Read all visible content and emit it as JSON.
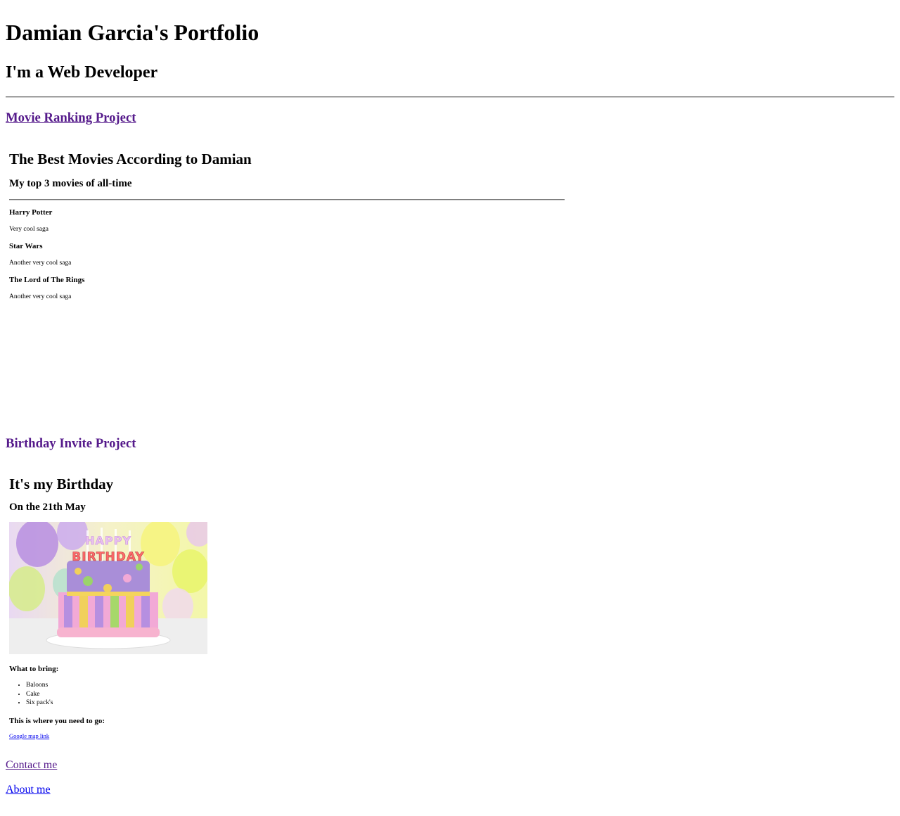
{
  "header": {
    "title": "Damian Garcia's Portfolio",
    "subtitle": "I'm a Web Developer"
  },
  "projects": {
    "movie": {
      "link_label": "Movie Ranking Project",
      "heading": "The Best Movies According to Damian",
      "subheading": "My top 3 movies of all-time",
      "movies": [
        {
          "title": "Harry Potter",
          "description": "Very cool saga"
        },
        {
          "title": "Star Wars",
          "description": "Another very cool saga"
        },
        {
          "title": "The Lord of The Rings",
          "description": "Another very cool saga"
        }
      ]
    },
    "birthday": {
      "link_label": "Birthday Invite Project",
      "heading": "It's my Birthday",
      "date_line": "On the 21th May",
      "image_text": "HAPPY BIRTHDAY",
      "bring_heading": "What to bring:",
      "bring_items": [
        "Baloons",
        "Cake",
        "Six pack's"
      ],
      "where_heading": "This is where you need to go:",
      "map_link": "Google map link"
    }
  },
  "footer": {
    "contact_label": "Contact me",
    "about_label": "About me"
  },
  "colors": {
    "visited_link": "#551a8b",
    "unvisited_link": "#0000ee"
  }
}
